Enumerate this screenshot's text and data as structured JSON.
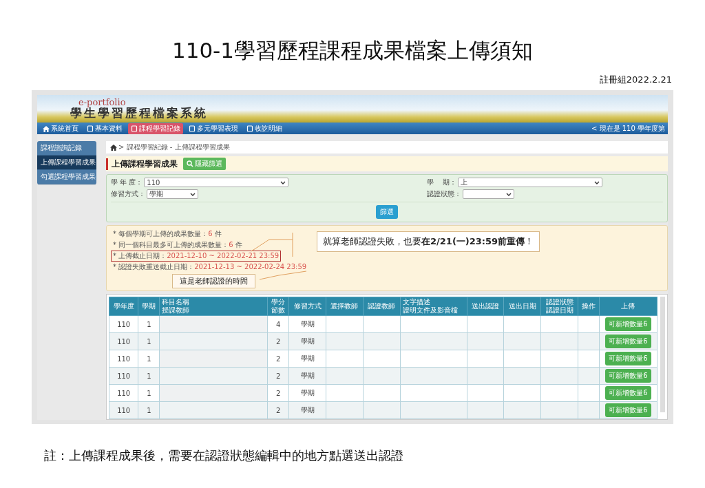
{
  "slide": {
    "title": "110-1學習歷程課程成果檔案上傳須知",
    "author_date": "註冊組2022.2.21",
    "footnote": "註：上傳課程成果後，需要在認證狀態編輯中的地方點選送出認證"
  },
  "portal": {
    "logo_subtitle": "e-portfolio",
    "logo_title": "學生學習歷程檔案系統",
    "nav": [
      {
        "label": "系統首頁",
        "kind": "home",
        "selected": false
      },
      {
        "label": "基本資料",
        "kind": "page",
        "selected": false
      },
      {
        "label": "課程學習記錄",
        "kind": "page",
        "selected": true
      },
      {
        "label": "多元學習表現",
        "kind": "page",
        "selected": false
      },
      {
        "label": "收訖明細",
        "kind": "page",
        "selected": false
      }
    ],
    "nav_status": "< 現在是 110 學年度第",
    "sidebar": [
      {
        "label": "課程諮詢記錄",
        "selected": false
      },
      {
        "label": "上傳課程學習成果",
        "selected": true
      },
      {
        "label": "勾選課程學習成果",
        "selected": false
      }
    ],
    "breadcrumb": "> 課程學習紀錄 - 上傳課程學習成果",
    "heading": "上傳課程學習成果",
    "toggle_button": "隱藏篩選",
    "filters": [
      {
        "label": "學 年 度：",
        "value": "110"
      },
      {
        "label": "學　 期：",
        "value": "上"
      },
      {
        "label": "修習方式：",
        "value": "學期"
      },
      {
        "label": "認證狀態："
      }
    ],
    "filter_button": "篩選",
    "notes": [
      {
        "label": "* 每個學期可上傳的成果數量：",
        "value": "6",
        "unit": "件",
        "highlighted": false
      },
      {
        "label": "* 同一個科目最多可上傳的成果數量：",
        "value": "6",
        "unit": "件",
        "highlighted": false
      },
      {
        "label": "* 上傳截止日期：",
        "value": "2021-12-10 ~ 2022-02-21 23:59",
        "highlighted": true
      },
      {
        "label": "* 認證失敗重送截止日期：",
        "value": "2021-12-13 ~ 2022-02-24 23:59",
        "highlighted": false
      }
    ],
    "callouts": [
      {
        "text": "就算老師認證失敗，也要**在2/21(一)23:59前重傳**！"
      },
      {
        "text": "這是老師認證的時間"
      }
    ],
    "table": {
      "columns": [
        [
          "學年度"
        ],
        [
          "學期"
        ],
        [
          "科目名稱",
          "授課教師"
        ],
        [
          "學分",
          "節數"
        ],
        [
          "修習方式"
        ],
        [
          "選擇教師"
        ],
        [
          "認證教師"
        ],
        [
          "文字描述",
          "證明文件及影音檔"
        ],
        [
          "送出認證"
        ],
        [
          "送出日期"
        ],
        [
          "認證狀態",
          "認證日期"
        ],
        [
          "操作"
        ],
        [
          "上傳"
        ]
      ],
      "rows": [
        {
          "year": "110",
          "term": "1",
          "credits": "4",
          "mode": "學期",
          "upload_button": "可新增數量6"
        },
        {
          "year": "110",
          "term": "1",
          "credits": "2",
          "mode": "學期",
          "upload_button": "可新增數量6"
        },
        {
          "year": "110",
          "term": "1",
          "credits": "2",
          "mode": "學期",
          "upload_button": "可新增數量6"
        },
        {
          "year": "110",
          "term": "1",
          "credits": "2",
          "mode": "學期",
          "upload_button": "可新增數量6"
        },
        {
          "year": "110",
          "term": "1",
          "credits": "2",
          "mode": "學期",
          "upload_button": "可新增數量6"
        },
        {
          "year": "110",
          "term": "1",
          "credits": "2",
          "mode": "學期",
          "upload_button": "可新增數量6"
        }
      ]
    }
  }
}
